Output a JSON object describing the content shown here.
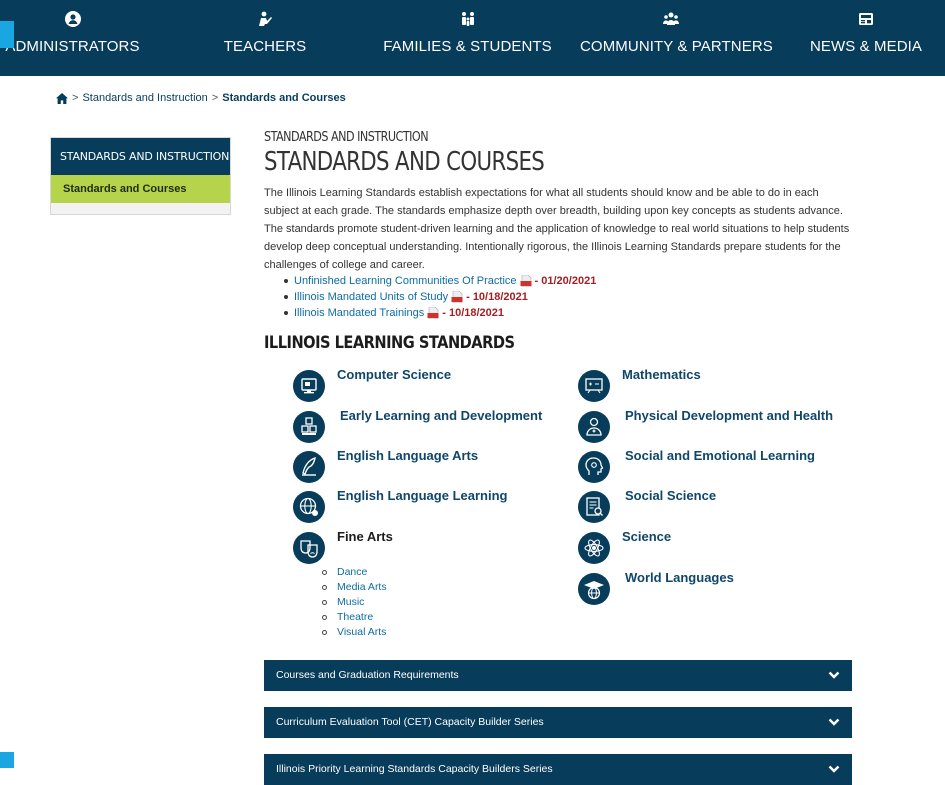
{
  "nav": {
    "items": [
      {
        "label": "ADMINISTRATORS",
        "icon": "user-icon"
      },
      {
        "label": "TEACHERS",
        "icon": "teacher-icon"
      },
      {
        "label": "FAMILIES & STUDENTS",
        "icon": "family-icon"
      },
      {
        "label": "COMMUNITY & PARTNERS",
        "icon": "group-icon"
      },
      {
        "label": "NEWS & MEDIA",
        "icon": "newspaper-icon"
      }
    ]
  },
  "breadcrumb": {
    "home_icon": "home-icon",
    "separator": ">",
    "parent": "Standards and Instruction",
    "current": "Standards and Courses"
  },
  "sidebar": {
    "heading": "STANDARDS AND INSTRUCTION",
    "items": [
      {
        "label": "Standards and Courses",
        "active": true
      }
    ]
  },
  "main": {
    "kicker": "STANDARDS AND INSTRUCTION",
    "title": "STANDARDS AND COURSES",
    "intro": "The Illinois Learning Standards establish expectations for what all students should know and be able to do in each subject at each grade. The standards emphasize depth over breadth, building upon key concepts as students advance. The standards promote student-driven learning and the application of knowledge to real world situations to help students develop deep conceptual understanding. Intentionally rigorous, the Illinois Learning Standards prepare students for the challenges of college and career.",
    "documents": [
      {
        "label": "Unfinished Learning Communities Of Practice",
        "date": "- 01/20/2021",
        "icon": "pdf-icon"
      },
      {
        "label": "Illinois Mandated Units of Study",
        "date": "- 10/18/2021",
        "icon": "pdf-icon"
      },
      {
        "label": "Illinois Mandated Trainings",
        "date": "- 10/18/2021",
        "icon": "pdf-icon"
      }
    ],
    "standards_heading": "ILLINOIS LEARNING STANDARDS",
    "subjects_left": [
      {
        "label": "Computer Science",
        "icon": "computer-science-icon"
      },
      {
        "label": "Early Learning and Development",
        "icon": "blocks-icon"
      },
      {
        "label": "English Language Arts",
        "icon": "quill-icon"
      },
      {
        "label": "English Language Learning",
        "icon": "globe-icon"
      },
      {
        "label": "Fine Arts",
        "icon": "theater-masks-icon"
      }
    ],
    "subjects_right": [
      {
        "label": "Mathematics",
        "icon": "chalkboard-icon"
      },
      {
        "label": "Physical Development and Health",
        "icon": "health-person-icon"
      },
      {
        "label": "Social and Emotional Learning",
        "icon": "head-icon"
      },
      {
        "label": "Social Science",
        "icon": "document-search-icon"
      },
      {
        "label": "Science",
        "icon": "atom-icon"
      },
      {
        "label": "World Languages",
        "icon": "graduation-globe-icon"
      }
    ],
    "fine_arts_sub": [
      "Dance",
      "Media Arts",
      "Music",
      "Theatre",
      "Visual Arts"
    ],
    "accordions": [
      {
        "label": "Courses and Graduation Requirements",
        "icon": "chevron-down-icon"
      },
      {
        "label": "Curriculum Evaluation Tool (CET) Capacity Builder Series",
        "icon": "chevron-down-icon"
      },
      {
        "label": "Illinois Priority Learning Standards Capacity Builders Series",
        "icon": "chevron-down-icon"
      }
    ]
  },
  "colors": {
    "navy": "#073c5a",
    "accent_green": "#b5d44b",
    "accent_blue": "#1aa6e0",
    "link": "#0e6ca3",
    "date_red": "#a31f24"
  }
}
